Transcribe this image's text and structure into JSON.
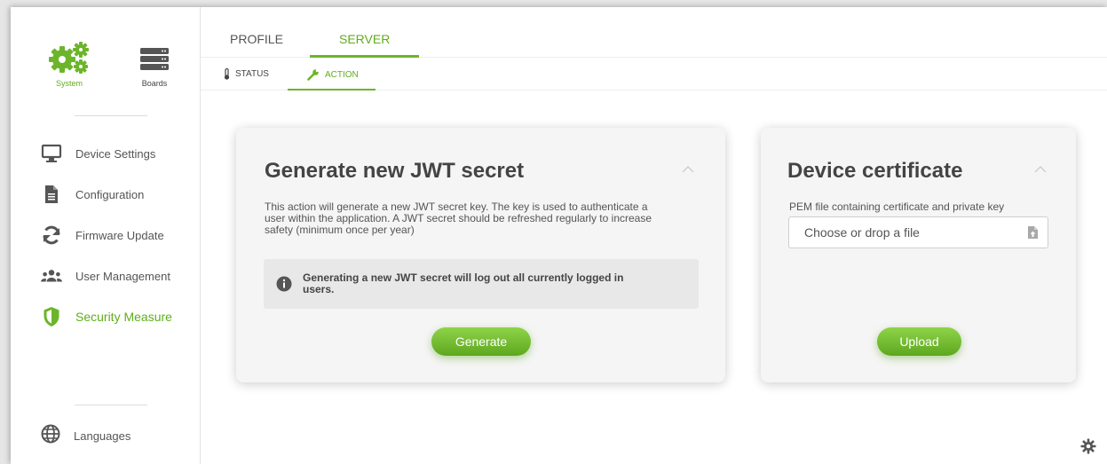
{
  "colors": {
    "accent": "#5fae1c",
    "button": "#6cb52a",
    "text": "#444444"
  },
  "sidebar": {
    "top": [
      {
        "label": "System",
        "icon": "gears-icon"
      },
      {
        "label": "Boards",
        "icon": "server-stack-icon"
      }
    ],
    "items": [
      {
        "label": "Device Settings",
        "icon": "monitor-icon"
      },
      {
        "label": "Configuration",
        "icon": "document-icon"
      },
      {
        "label": "Firmware Update",
        "icon": "refresh-icon"
      },
      {
        "label": "User Management",
        "icon": "users-icon"
      },
      {
        "label": "Security Measure",
        "icon": "shield-icon"
      }
    ],
    "languages": {
      "label": "Languages",
      "icon": "globe-icon"
    }
  },
  "tabs": [
    "PROFILE",
    "SERVER"
  ],
  "subtabs": [
    {
      "label": "STATUS",
      "icon": "thermometer-icon"
    },
    {
      "label": "ACTION",
      "icon": "wrench-icon"
    }
  ],
  "jwt_card": {
    "title": "Generate new JWT secret",
    "description_lines": [
      "This action will generate a new JWT secret key. The key is used to authenticate a",
      "user within the application. A JWT secret should be refreshed regularly to increase",
      "safety (minimum once per year)"
    ],
    "info_lines": [
      "Generating a new JWT secret will log out all currently logged in",
      "users."
    ],
    "button": "Generate"
  },
  "cert_card": {
    "title": "Device certificate",
    "label": "PEM file containing certificate and private key",
    "file_placeholder": "Choose or drop a file",
    "button": "Upload"
  }
}
